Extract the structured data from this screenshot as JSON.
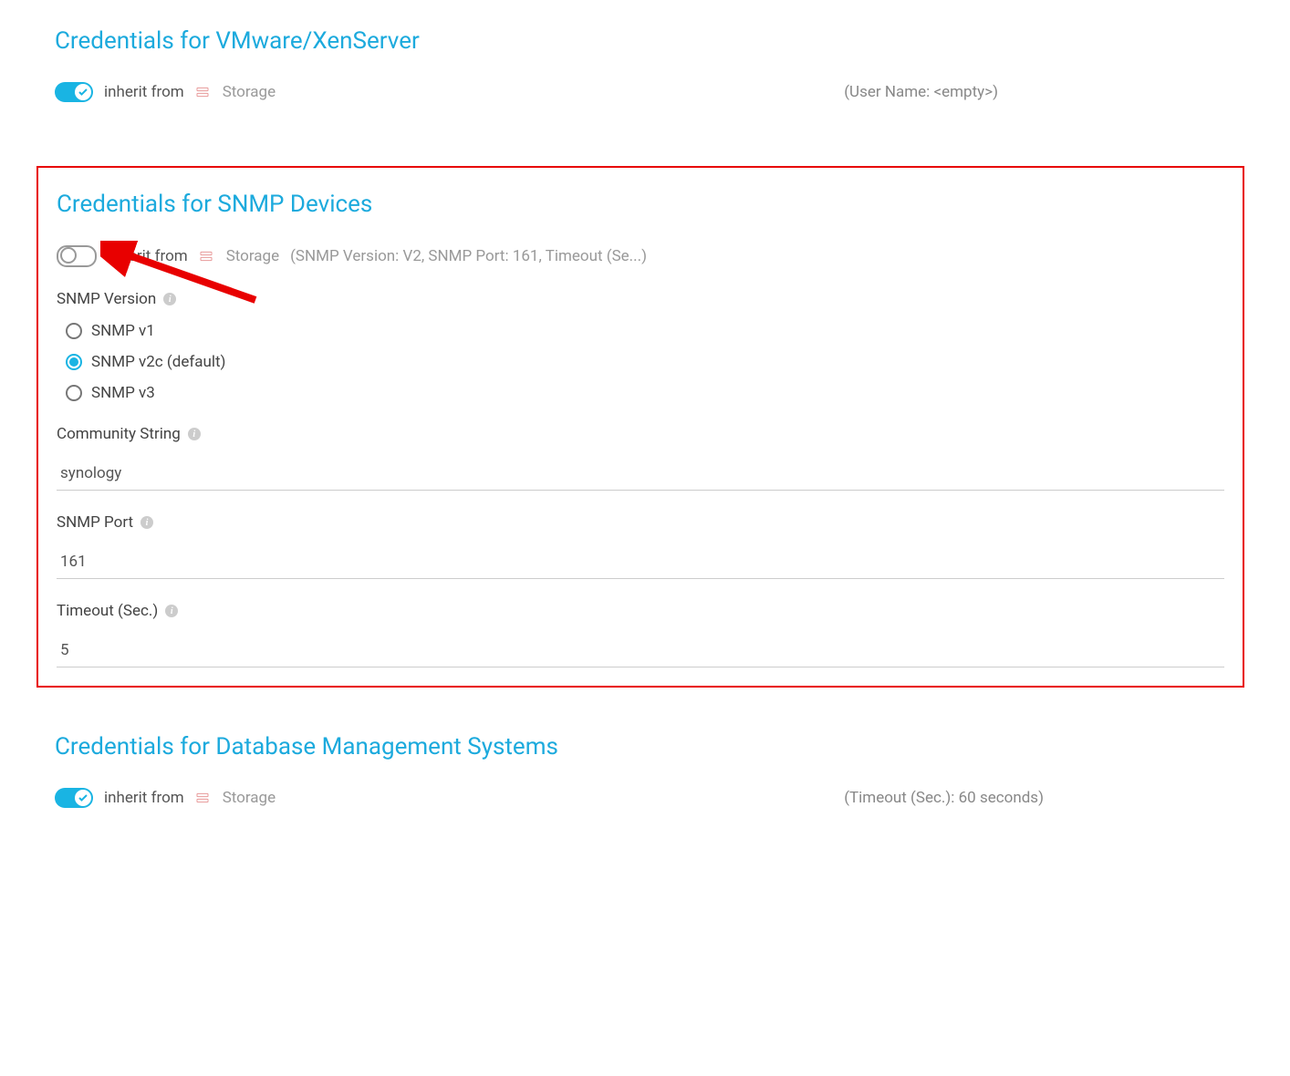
{
  "vmware": {
    "title": "Credentials for VMware/XenServer",
    "inherit_label": "inherit from",
    "inherit_source": "Storage",
    "summary": "(User Name: <empty>)"
  },
  "snmp": {
    "title": "Credentials for SNMP Devices",
    "inherit_label": "inherit from",
    "inherit_source": "Storage",
    "summary": "(SNMP Version: V2, SNMP Port: 161, Timeout (Se...)",
    "version_label": "SNMP Version",
    "version_options": {
      "v1": "SNMP v1",
      "v2c": "SNMP v2c (default)",
      "v3": "SNMP v3"
    },
    "community_label": "Community String",
    "community_value": "synology",
    "port_label": "SNMP Port",
    "port_value": "161",
    "timeout_label": "Timeout (Sec.)",
    "timeout_value": "5"
  },
  "dbms": {
    "title": "Credentials for Database Management Systems",
    "inherit_label": "inherit from",
    "inherit_source": "Storage",
    "summary": "(Timeout (Sec.): 60 seconds)"
  }
}
